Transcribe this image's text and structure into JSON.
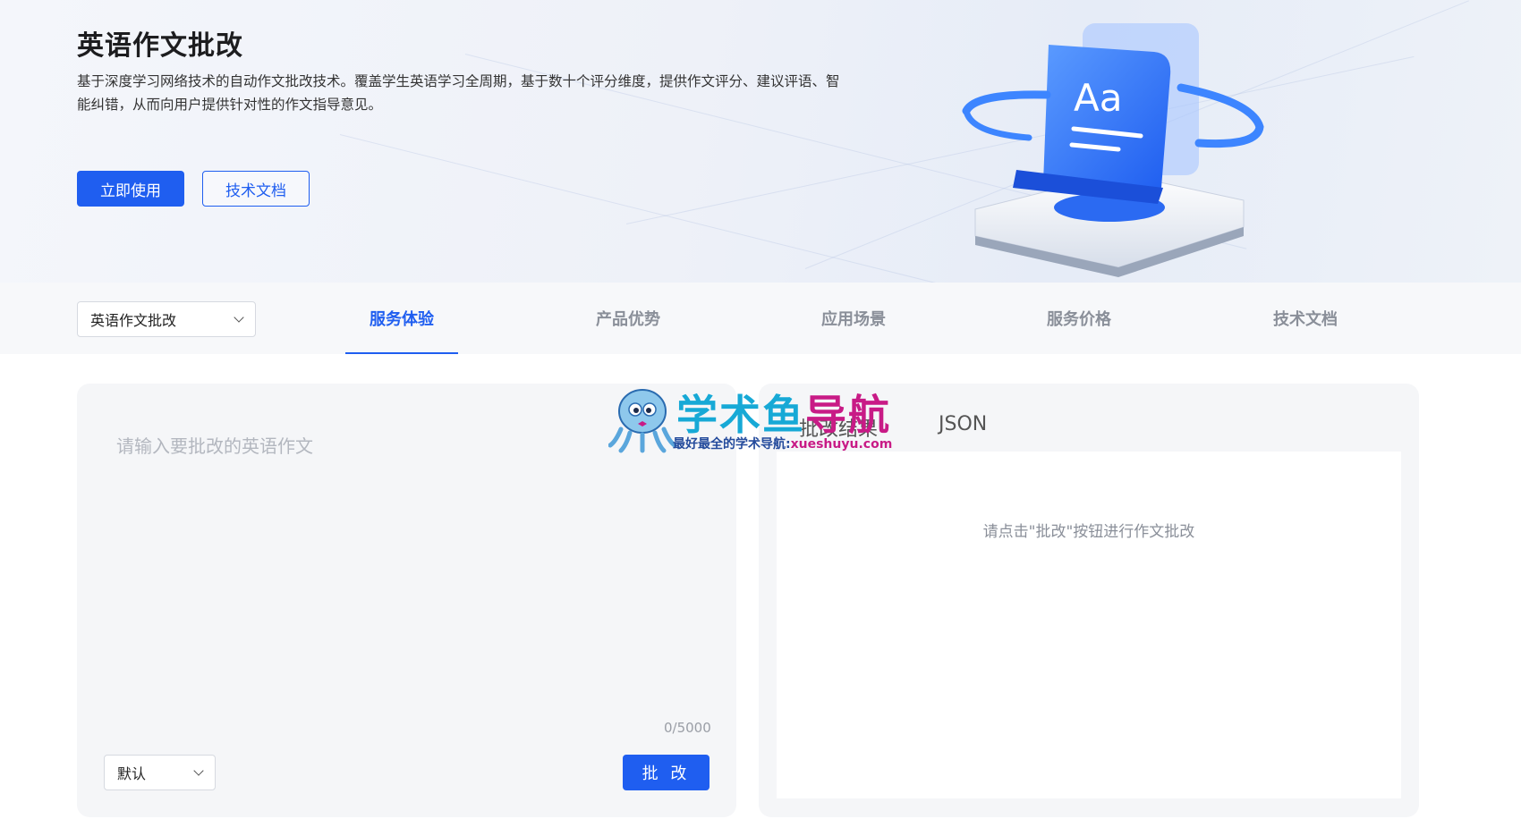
{
  "banner": {
    "title": "英语作文批改",
    "description": "基于深度学习网络技术的自动作文批改技术。覆盖学生英语学习全周期，基于数十个评分维度，提供作文评分、建议评语、智能纠错，从而向用户提供针对性的作文指导意见。",
    "primary_button": "立即使用",
    "secondary_button": "技术文档",
    "illustration_text": "Aa"
  },
  "nav": {
    "product_select": "英语作文批改",
    "tabs": [
      {
        "label": "服务体验",
        "active": true
      },
      {
        "label": "产品优势",
        "active": false
      },
      {
        "label": "应用场景",
        "active": false
      },
      {
        "label": "服务价格",
        "active": false
      },
      {
        "label": "技术文档",
        "active": false
      }
    ]
  },
  "input_panel": {
    "placeholder": "请输入要批改的英语作文",
    "counter": "0/5000",
    "mode_select": "默认",
    "submit_button": "批 改"
  },
  "result_panel": {
    "tabs": [
      "批改结果",
      "JSON"
    ],
    "hint": "请点击\"批改\"按钮进行作文批改"
  },
  "watermark": {
    "title_part1": "学术鱼",
    "title_part2": "导航",
    "subtitle": "最好最全的学术导航:",
    "url": "xueshuyu.com"
  },
  "colors": {
    "accent": "#1f5ef0",
    "watermark_blue": "#17a9d6",
    "watermark_magenta": "#c81b86"
  }
}
